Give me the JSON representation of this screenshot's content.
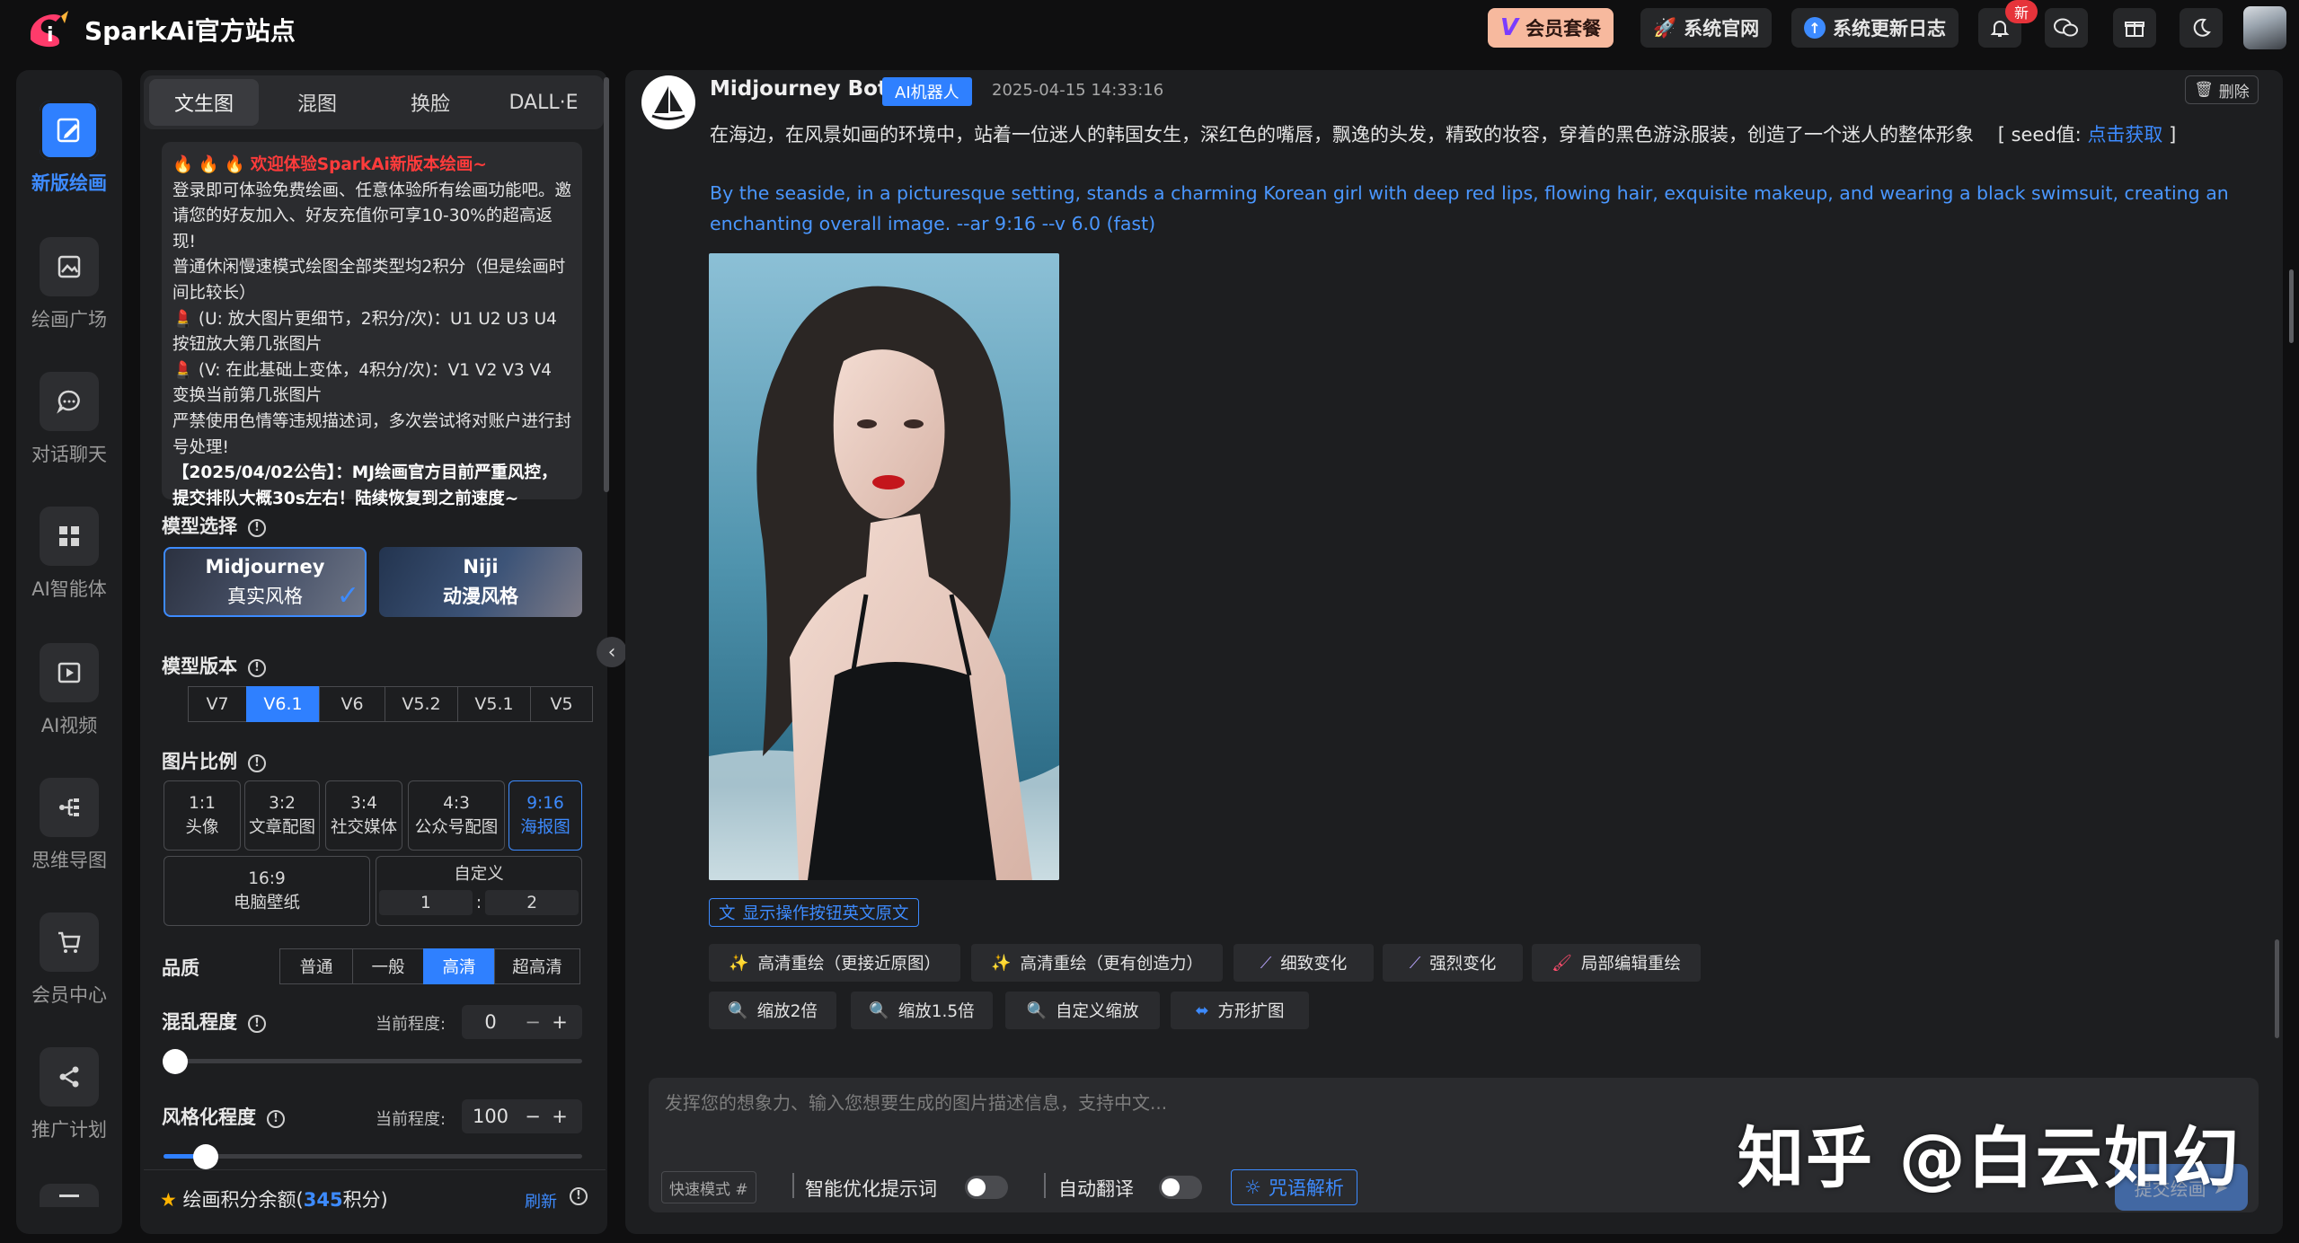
{
  "app": {
    "title": "SparkAi官方站点",
    "accent": "#2f80ff"
  },
  "topbar": {
    "vip_label": "会员套餐",
    "official_label": "系统官网",
    "changelog_label": "系统更新日志",
    "new_badge": "新",
    "icons": [
      "bell-icon",
      "wechat-icon",
      "gift-icon",
      "moon-icon"
    ]
  },
  "nav": {
    "items": [
      {
        "label": "新版绘画",
        "icon": "pen-icon",
        "active": true
      },
      {
        "label": "绘画广场",
        "icon": "gallery-icon"
      },
      {
        "label": "对话聊天",
        "icon": "chat-icon"
      },
      {
        "label": "AI智能体",
        "icon": "grid-icon"
      },
      {
        "label": "AI视频",
        "icon": "video-icon"
      },
      {
        "label": "思维导图",
        "icon": "mindmap-icon"
      },
      {
        "label": "会员中心",
        "icon": "cart-icon"
      },
      {
        "label": "推广计划",
        "icon": "share-icon"
      }
    ]
  },
  "panel": {
    "tabs": [
      "文生图",
      "混图",
      "换脸",
      "DALL·E"
    ],
    "notice": {
      "headline": "欢迎体验SparkAi新版本绘画~",
      "p1": "登录即可体验免费绘画、任意体验所有绘画功能吧。邀请您的好友加入、好友充值你可享10-30%的超高返现!",
      "p2": "普通休闲慢速模式绘图全部类型均2积分（但是绘画时间比较长）",
      "p3": "(U: 放大图片更细节，2积分/次)：U1 U2 U3 U4按钮放大第几张图片",
      "p4": "(V: 在此基础上变体，4积分/次)：V1 V2 V3 V4 变换当前第几张图片",
      "p5": "严禁使用色情等违规描述词，多次尝试将对账户进行封号处理!",
      "p6": "【2025/04/02公告】：MJ绘画官方目前严重风控，提交排队大概30s左右！陆续恢复到之前速度~"
    },
    "model_title": "模型选择",
    "models": [
      {
        "name": "Midjourney",
        "style": "真实风格",
        "selected": true
      },
      {
        "name": "Niji",
        "style": "动漫风格"
      }
    ],
    "version_title": "模型版本",
    "versions": [
      "V7",
      "V6.1",
      "V6",
      "V5.2",
      "V5.1",
      "V5"
    ],
    "version_selected": "V6.1",
    "ratio_title": "图片比例",
    "ratios": [
      {
        "ratio": "1:1",
        "label": "头像"
      },
      {
        "ratio": "3:2",
        "label": "文章配图"
      },
      {
        "ratio": "3:4",
        "label": "社交媒体"
      },
      {
        "ratio": "4:3",
        "label": "公众号配图"
      },
      {
        "ratio": "9:16",
        "label": "海报图",
        "selected": true
      }
    ],
    "ratio_wide": {
      "ratio": "16:9",
      "label": "电脑壁纸"
    },
    "ratio_custom": {
      "label": "自定义",
      "w": "1",
      "sep": ":",
      "h": "2"
    },
    "quality_title": "品质",
    "qualities": [
      "普通",
      "一般",
      "高清",
      "超高清"
    ],
    "quality_selected": "高清",
    "chaos_title": "混乱程度",
    "current_label": "当前程度:",
    "chaos_value": "0",
    "chaos_level": 0,
    "stylize_title": "风格化程度",
    "stylize_value": "100",
    "stylize_level": 0.1,
    "minus": "−",
    "plus": "+",
    "points_label": "绘画积分余额(",
    "points_value": "345",
    "points_unit": "积分)",
    "refresh_label": "刷新"
  },
  "message": {
    "bot_name": "Midjourney Bot",
    "bot_tag": "AI机器人",
    "time": "2025-04-15 14:33:16",
    "delete_label": "删除",
    "prompt_cn": "在海边，在风景如画的环境中，站着一位迷人的韩国女生，深红色的嘴唇，飘逸的头发，精致的妆容，穿着的黑色游泳服装，创造了一个迷人的整体形象",
    "seed_prefix": "[ seed值: ",
    "seed_link": "点击获取",
    "seed_suffix": " ]",
    "prompt_en": "By the seaside, in a picturesque setting, stands a charming Korean girl with deep red lips, flowing hair, exquisite makeup, and wearing a black swimsuit, creating an enchanting overall image. --ar 9:16 --v 6.0  (fast)",
    "show_en_label": "显示操作按钮英文原文",
    "actions_row1": [
      {
        "label": "高清重绘（更接近原图）",
        "icon": "sparkle-icon"
      },
      {
        "label": "高清重绘（更有创造力）",
        "icon": "sparkle-icon"
      },
      {
        "label": "细致变化",
        "icon": "wand-icon"
      },
      {
        "label": "强烈变化",
        "icon": "wand-icon"
      },
      {
        "label": "局部编辑重绘",
        "icon": "brush-icon"
      }
    ],
    "actions_row2": [
      {
        "label": "缩放2倍",
        "icon": "zoom-icon"
      },
      {
        "label": "缩放1.5倍",
        "icon": "zoom-icon"
      },
      {
        "label": "自定义缩放",
        "icon": "zoom-icon"
      },
      {
        "label": "方形扩图",
        "icon": "expand-icon"
      }
    ]
  },
  "composer": {
    "placeholder": "发挥您的想象力、输入您想要生成的图片描述信息，支持中文...",
    "fast_mode": "快速模式 #",
    "smart_optimize": "智能优化提示词",
    "auto_translate": "自动翻译",
    "spell_parse": "咒语解析",
    "submit": "提交绘画"
  },
  "watermark": "知乎 @白云如幻"
}
